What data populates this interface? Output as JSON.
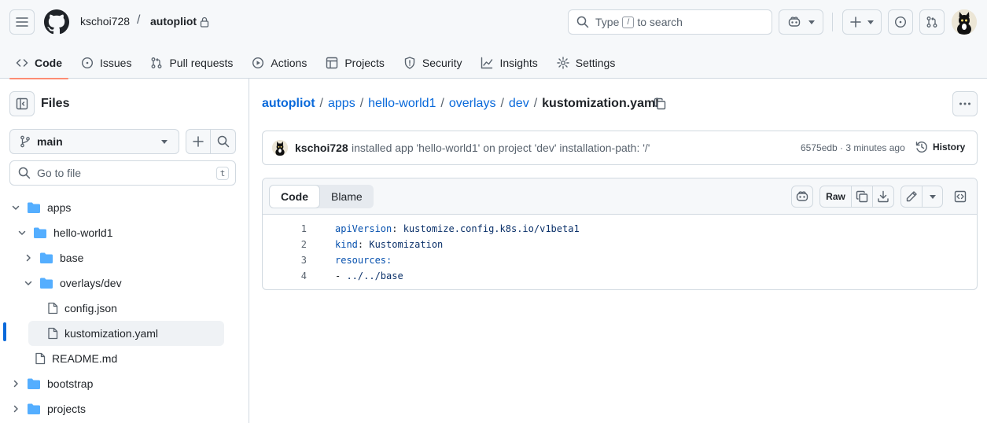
{
  "header": {
    "owner": "kschoi728",
    "separator": "/",
    "repo": "autopliot",
    "search_prefix": "Type",
    "search_key": "/",
    "search_suffix": "to search"
  },
  "nav": {
    "tabs": [
      {
        "label": "Code",
        "icon": "code-icon",
        "active": true
      },
      {
        "label": "Issues",
        "icon": "issue-opened-icon"
      },
      {
        "label": "Pull requests",
        "icon": "git-pull-request-icon"
      },
      {
        "label": "Actions",
        "icon": "play-icon"
      },
      {
        "label": "Projects",
        "icon": "table-icon"
      },
      {
        "label": "Security",
        "icon": "shield-icon"
      },
      {
        "label": "Insights",
        "icon": "graph-icon"
      },
      {
        "label": "Settings",
        "icon": "gear-icon"
      }
    ]
  },
  "sidebar": {
    "title": "Files",
    "branch": "main",
    "goto_placeholder": "Go to file",
    "goto_shortcut": "t",
    "tree": [
      {
        "label": "apps",
        "type": "folder",
        "expanded": true,
        "depth": 0
      },
      {
        "label": "hello-world1",
        "type": "folder",
        "expanded": true,
        "depth": 1
      },
      {
        "label": "base",
        "type": "folder",
        "expanded": false,
        "depth": 2
      },
      {
        "label": "overlays/dev",
        "type": "folder",
        "expanded": true,
        "depth": 2
      },
      {
        "label": "config.json",
        "type": "file",
        "depth": 3
      },
      {
        "label": "kustomization.yaml",
        "type": "file",
        "depth": 3,
        "selected": true
      },
      {
        "label": "README.md",
        "type": "file",
        "depth": 2
      },
      {
        "label": "bootstrap",
        "type": "folder",
        "expanded": false,
        "depth": 0
      },
      {
        "label": "projects",
        "type": "folder",
        "expanded": false,
        "depth": 0
      }
    ]
  },
  "breadcrumb": {
    "parts": [
      "autopliot",
      "apps",
      "hello-world1",
      "overlays",
      "dev"
    ],
    "separator": "/",
    "current": "kustomization.yaml"
  },
  "commit": {
    "author": "kschoi728",
    "message": "installed app 'hello-world1' on project 'dev' installation-path: '/'",
    "meta": "6575edb · 3 minutes ago",
    "history_label": "History"
  },
  "file": {
    "tab_code": "Code",
    "tab_blame": "Blame",
    "raw_label": "Raw",
    "lines": [
      {
        "num": "1",
        "key": "apiVersion",
        "sep": ": ",
        "value": "kustomize.config.k8s.io/v1beta1"
      },
      {
        "num": "2",
        "key": "kind",
        "sep": ": ",
        "value": "Kustomization"
      },
      {
        "num": "3",
        "key": "resources",
        "sep": ":",
        "value": ""
      },
      {
        "num": "4",
        "key": "",
        "sep": "- ",
        "value": "../../base"
      }
    ]
  },
  "colors": {
    "accent": "#0969da",
    "active_underline": "#fd8c73",
    "folder": "#54aeff",
    "border": "#d1d9e0"
  }
}
